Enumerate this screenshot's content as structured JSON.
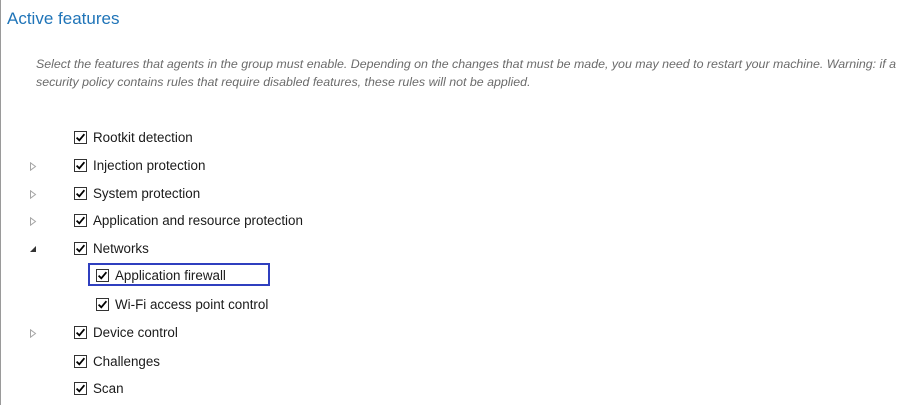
{
  "section": {
    "title": "Active features",
    "description": "Select the features that agents in the group must enable. Depending on the changes that must be made, you may need to restart your machine. Warning: if a security policy contains rules that require disabled features, these rules will not be applied."
  },
  "features": [
    {
      "label": "Rootkit detection",
      "checked": true,
      "expander": "none"
    },
    {
      "label": "Injection protection",
      "checked": true,
      "expander": "collapsed"
    },
    {
      "label": "System protection",
      "checked": true,
      "expander": "collapsed"
    },
    {
      "label": "Application and resource protection",
      "checked": true,
      "expander": "collapsed"
    },
    {
      "label": "Networks",
      "checked": true,
      "expander": "expanded",
      "children": [
        {
          "label": "Application firewall",
          "checked": true,
          "highlighted": true
        },
        {
          "label": "Wi-Fi access point control",
          "checked": true
        }
      ]
    },
    {
      "label": "Device control",
      "checked": true,
      "expander": "collapsed"
    },
    {
      "label": "Challenges",
      "checked": true,
      "expander": "none"
    },
    {
      "label": "Scan",
      "checked": true,
      "expander": "none"
    }
  ],
  "colors": {
    "title": "#1f74b8",
    "description": "#6b6b6b",
    "highlight_border": "#2f3fbf",
    "expander_collapsed": "#a6a6a6",
    "expander_expanded": "#333333"
  }
}
